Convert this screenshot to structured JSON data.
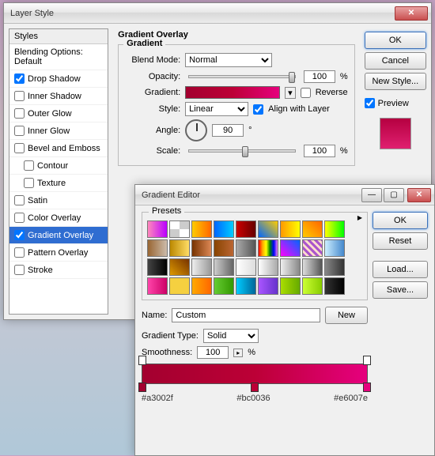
{
  "layerStyle": {
    "title": "Layer Style",
    "stylesHeader": "Styles",
    "blendingOptions": "Blending Options: Default",
    "effects": [
      {
        "label": "Drop Shadow",
        "checked": true,
        "selected": false
      },
      {
        "label": "Inner Shadow",
        "checked": false,
        "selected": false
      },
      {
        "label": "Outer Glow",
        "checked": false,
        "selected": false
      },
      {
        "label": "Inner Glow",
        "checked": false,
        "selected": false
      },
      {
        "label": "Bevel and Emboss",
        "checked": false,
        "selected": false
      },
      {
        "label": "Contour",
        "checked": false,
        "selected": false,
        "indent": true
      },
      {
        "label": "Texture",
        "checked": false,
        "selected": false,
        "indent": true
      },
      {
        "label": "Satin",
        "checked": false,
        "selected": false
      },
      {
        "label": "Color Overlay",
        "checked": false,
        "selected": false
      },
      {
        "label": "Gradient Overlay",
        "checked": true,
        "selected": true
      },
      {
        "label": "Pattern Overlay",
        "checked": false,
        "selected": false
      },
      {
        "label": "Stroke",
        "checked": false,
        "selected": false
      }
    ],
    "panel": {
      "heading": "Gradient Overlay",
      "subheading": "Gradient",
      "blendModeLabel": "Blend Mode:",
      "blendModeValue": "Normal",
      "opacityLabel": "Opacity:",
      "opacityValue": "100",
      "pct": "%",
      "gradientLabel": "Gradient:",
      "reverseLabel": "Reverse",
      "styleLabel": "Style:",
      "styleValue": "Linear",
      "alignLabel": "Align with Layer",
      "angleLabel": "Angle:",
      "angleValue": "90",
      "deg": "°",
      "scaleLabel": "Scale:",
      "scaleValue": "100"
    },
    "buttons": {
      "ok": "OK",
      "cancel": "Cancel",
      "newStyle": "New Style...",
      "preview": "Preview"
    }
  },
  "gradientEditor": {
    "title": "Gradient Editor",
    "presetsLabel": "Presets",
    "nameLabel": "Name:",
    "nameValue": "Custom",
    "newBtn": "New",
    "gradTypeLabel": "Gradient Type:",
    "gradTypeValue": "Solid",
    "smoothLabel": "Smoothness:",
    "smoothValue": "100",
    "pct": "%",
    "buttons": {
      "ok": "OK",
      "reset": "Reset",
      "load": "Load...",
      "save": "Save..."
    },
    "stops": {
      "left": "#a3002f",
      "mid": "#bc0036",
      "right": "#e6007e"
    },
    "presetColors": [
      "linear-gradient(90deg,#f8b,#b0f)",
      "repeating-conic-gradient(#ccc 0 25%,#fff 0 50%)",
      "linear-gradient(90deg,#fc0,#f60)",
      "linear-gradient(90deg,#06f,#0cf)",
      "linear-gradient(90deg,#c00,#600)",
      "linear-gradient(45deg,#06f,#fc0)",
      "linear-gradient(90deg,#f90,#ff0)",
      "linear-gradient(45deg,#fc0,#f60)",
      "linear-gradient(90deg,#ff0,#0f0)",
      "linear-gradient(90deg,#963,#cba)",
      "linear-gradient(90deg,#b80,#fd6)",
      "linear-gradient(90deg,#730,#d85)",
      "linear-gradient(90deg,#840,#b63)",
      "linear-gradient(90deg,#aaa,#555)",
      "linear-gradient(90deg,red,orange,yellow,green,blue,violet)",
      "linear-gradient(45deg,#f0f,#06f)",
      "repeating-linear-gradient(45deg,#a5c,#a5c 3px,#fdc 3px,#fdc 6px)",
      "linear-gradient(90deg,#cef,#48c)",
      "linear-gradient(90deg,#444,#000)",
      "linear-gradient(45deg,#d90,#730)",
      "linear-gradient(90deg,#eee,#999)",
      "linear-gradient(90deg,#ccc,#666)",
      "linear-gradient(90deg,#fff,#ddd)",
      "linear-gradient(90deg,#fff,#aaa)",
      "linear-gradient(90deg,#eee,#888)",
      "linear-gradient(90deg,#ddd,#555)",
      "linear-gradient(90deg,#888,#333)",
      "linear-gradient(90deg,#f4a,#c06)",
      "#f5d040",
      "linear-gradient(90deg,#fa0,#f60)",
      "linear-gradient(90deg,#6c3,#390)",
      "linear-gradient(90deg,#0cf,#069)",
      "linear-gradient(90deg,#a5f,#63c)",
      "linear-gradient(90deg,#ad0,#6a0)",
      "linear-gradient(90deg,#cf3,#8c0)",
      "linear-gradient(90deg,#333,#000)"
    ]
  }
}
